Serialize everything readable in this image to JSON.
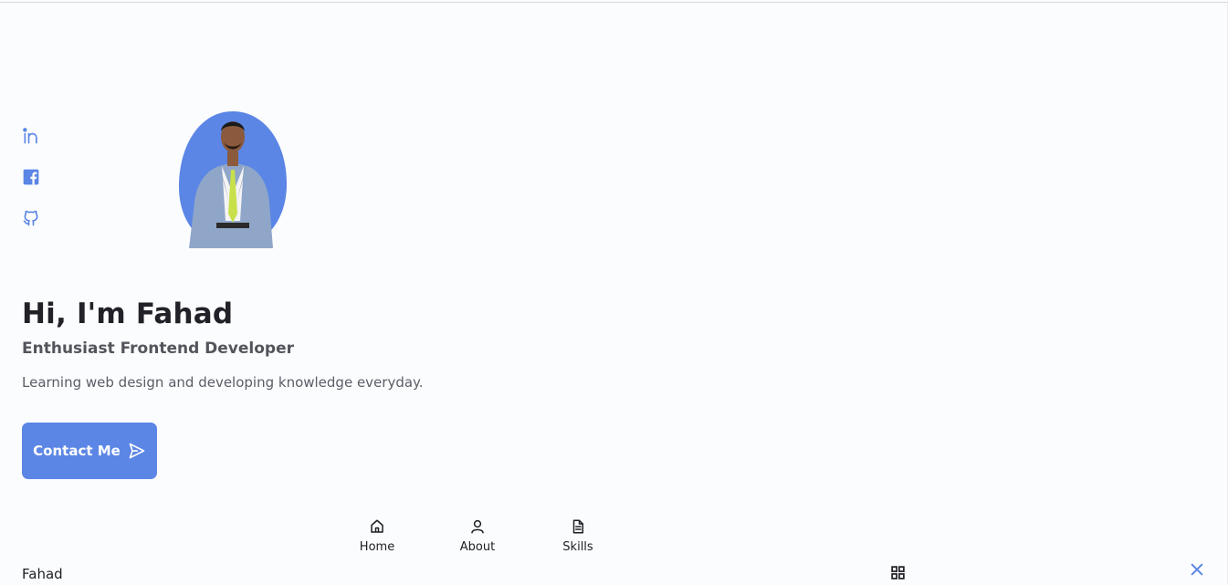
{
  "social": {
    "linkedin_icon": "linkedin-icon",
    "facebook_icon": "facebook-icon",
    "github_icon": "github-icon"
  },
  "hero": {
    "title": "Hi, I'm Fahad",
    "subtitle": "Enthusiast Frontend Developer",
    "description": "Learning web design and developing knowledge everyday.",
    "button_label": "Contact Me",
    "button_icon": "send-icon"
  },
  "nav": {
    "items": [
      {
        "label": "Home",
        "icon": "home-icon"
      },
      {
        "label": "About",
        "icon": "user-icon"
      },
      {
        "label": "Skills",
        "icon": "file-icon"
      }
    ]
  },
  "header": {
    "logo": "Fahad",
    "menu_icon": "grid-icon",
    "close_icon": "close-icon"
  },
  "colors": {
    "accent": "#5b86e5",
    "background": "#fbfcfe",
    "text": "#1e1e24",
    "muted": "#5c5d66"
  }
}
